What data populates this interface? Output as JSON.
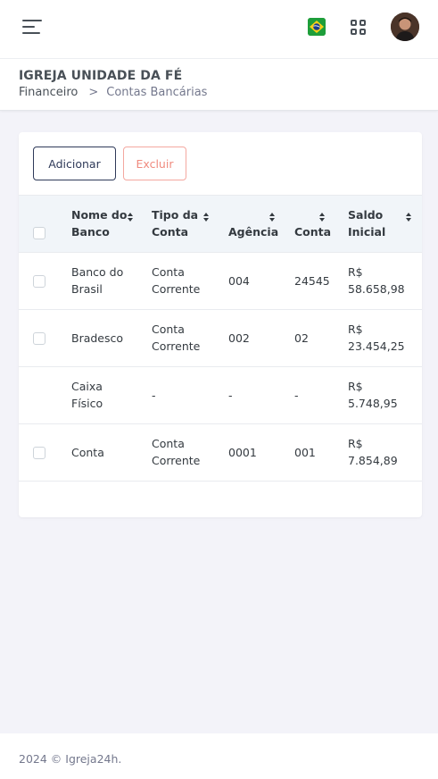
{
  "header": {
    "flag_icon": "brazil-flag-icon",
    "apps_icon": "grid-apps-icon",
    "menu_icon": "hamburger-menu-icon"
  },
  "page": {
    "title": "IGREJA UNIDADE DA FÉ",
    "breadcrumb": [
      "Financeiro",
      "Contas Bancárias"
    ],
    "breadcrumb_separator": ">"
  },
  "actions": {
    "add_label": "Adicionar",
    "delete_label": "Excluir"
  },
  "table": {
    "columns": [
      {
        "line1": "Nome do",
        "line2": "Banco"
      },
      {
        "line1": "Tipo da",
        "line2": "Conta"
      },
      {
        "line1": "",
        "line2": "Agência"
      },
      {
        "line1": "",
        "line2": "Conta"
      },
      {
        "line1": "Saldo",
        "line2": "Inicial"
      }
    ],
    "rows": [
      {
        "has_checkbox": true,
        "bank": [
          "Banco do",
          "Brasil"
        ],
        "type": [
          "Conta",
          "Corrente"
        ],
        "agency": "004",
        "account": "24545",
        "balance": [
          "R$",
          "58.658,98"
        ]
      },
      {
        "has_checkbox": true,
        "bank": [
          "Bradesco",
          ""
        ],
        "type": [
          "Conta",
          "Corrente"
        ],
        "agency": "002",
        "account": "02",
        "balance": [
          "R$",
          "23.454,25"
        ]
      },
      {
        "has_checkbox": false,
        "bank": [
          "Caixa",
          "Físico"
        ],
        "type": [
          "-",
          ""
        ],
        "agency": "-",
        "account": "-",
        "balance": [
          "R$",
          "5.748,95"
        ]
      },
      {
        "has_checkbox": true,
        "bank": [
          "Conta",
          ""
        ],
        "type": [
          "Conta",
          "Corrente"
        ],
        "agency": "0001",
        "account": "001",
        "balance": [
          "R$",
          "7.854,89"
        ]
      }
    ]
  },
  "footer": {
    "text": "2024 © Igreja24h."
  },
  "colors": {
    "primary_outline": "#2f3a59",
    "danger_outline": "#f08a7e",
    "table_header_bg": "#f1f5f9",
    "page_bg": "#f3f3f9"
  }
}
